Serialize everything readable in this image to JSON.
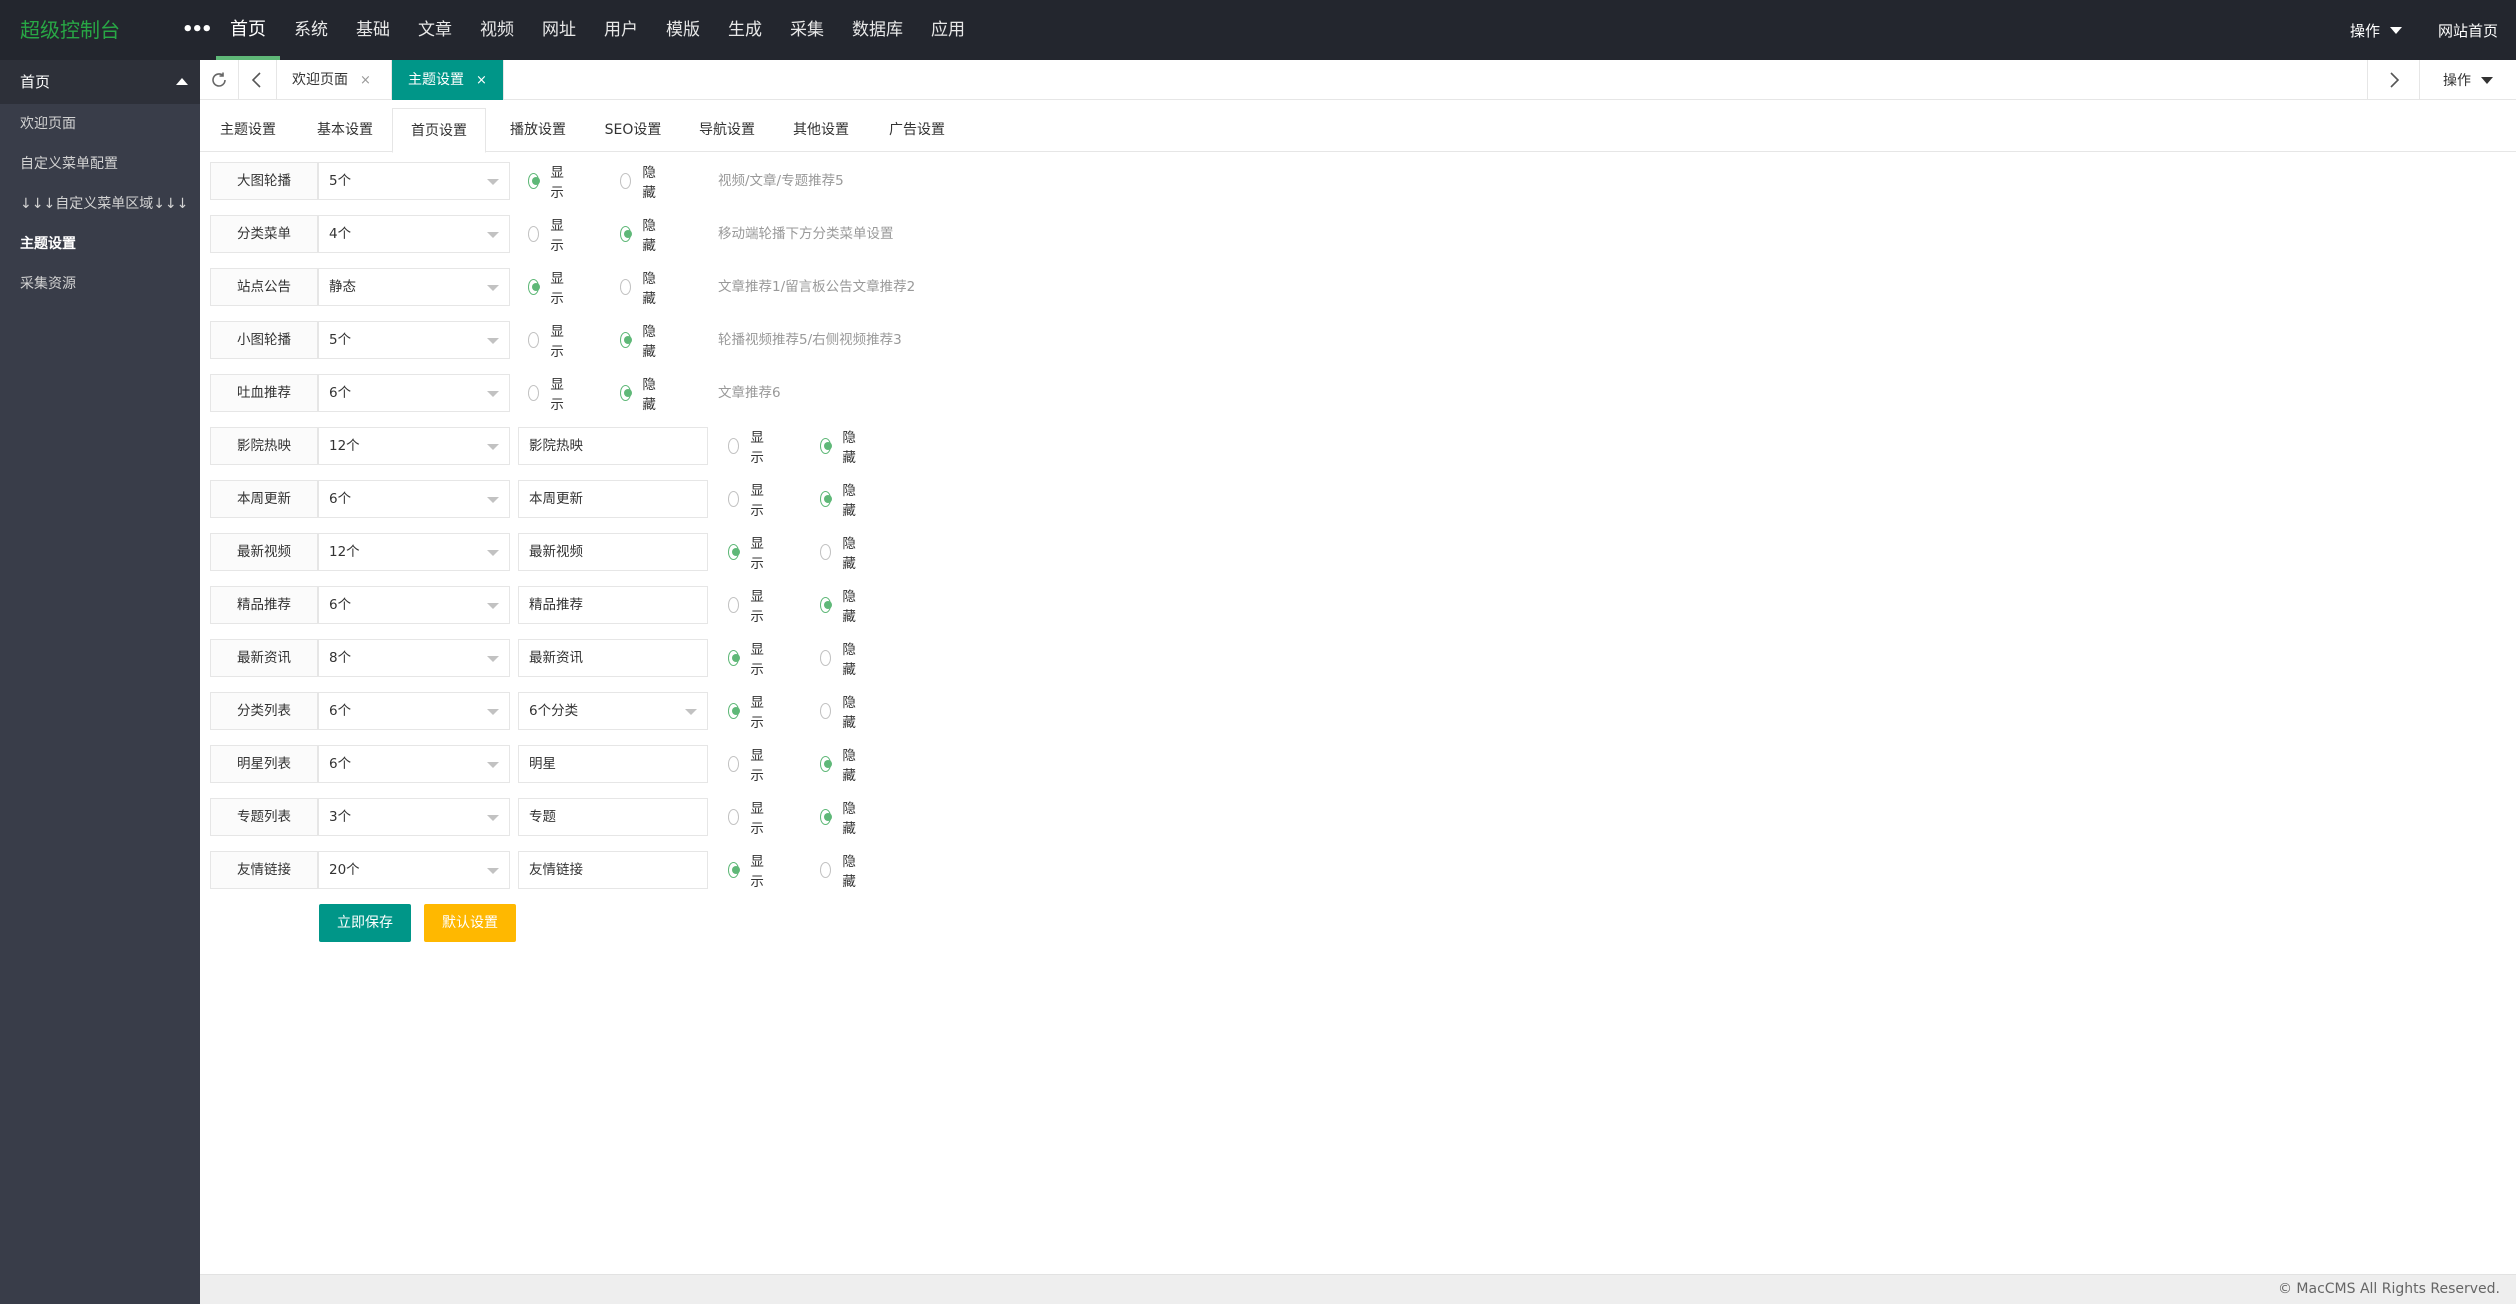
{
  "colors": {
    "accent": "#009688",
    "logo": "#28a745",
    "radio_on": "#5fb878",
    "warn": "#ffb800"
  },
  "header": {
    "logo": "超级控制台",
    "more": "•••",
    "nav": [
      {
        "label": "首页",
        "active": true
      },
      {
        "label": "系统"
      },
      {
        "label": "基础"
      },
      {
        "label": "文章"
      },
      {
        "label": "视频"
      },
      {
        "label": "网址"
      },
      {
        "label": "用户"
      },
      {
        "label": "模版"
      },
      {
        "label": "生成"
      },
      {
        "label": "采集"
      },
      {
        "label": "数据库"
      },
      {
        "label": "应用"
      }
    ],
    "operate": "操作",
    "site_home": "网站首页"
  },
  "sidebar": {
    "group": "首页",
    "items": [
      {
        "label": "欢迎页面"
      },
      {
        "label": "自定义菜单配置"
      },
      {
        "label": "↓↓↓自定义菜单区域↓↓↓"
      },
      {
        "label": "主题设置",
        "active": true
      },
      {
        "label": "采集资源"
      }
    ]
  },
  "tabstrip": {
    "tabs": [
      {
        "label": "欢迎页面",
        "close": "×"
      },
      {
        "label": "主题设置",
        "close": "×",
        "active": true
      }
    ],
    "operate": "操作"
  },
  "subtabs": [
    "主题设置",
    "基本设置",
    "首页设置",
    "播放设置",
    "SEO设置",
    "导航设置",
    "其他设置",
    "广告设置"
  ],
  "radio": {
    "show": "显示",
    "hide": "隐藏"
  },
  "rows_a": [
    {
      "label": "大图轮播",
      "count": "5个",
      "on": "show",
      "hint": "视频/文章/专题推荐5"
    },
    {
      "label": "分类菜单",
      "count": "4个",
      "on": "hide",
      "hint": "移动端轮播下方分类菜单设置"
    },
    {
      "label": "站点公告",
      "count": "静态",
      "on": "show",
      "hint": "文章推荐1/留言板公告文章推荐2"
    },
    {
      "label": "小图轮播",
      "count": "5个",
      "on": "hide",
      "hint": "轮播视频推荐5/右侧视频推荐3"
    },
    {
      "label": "吐血推荐",
      "count": "6个",
      "on": "hide",
      "hint": "文章推荐6"
    }
  ],
  "rows_b": [
    {
      "label": "影院热映",
      "count": "12个",
      "title": "影院热映",
      "on": "hide"
    },
    {
      "label": "本周更新",
      "count": "6个",
      "title": "本周更新",
      "on": "hide"
    },
    {
      "label": "最新视频",
      "count": "12个",
      "title": "最新视频",
      "on": "show"
    },
    {
      "label": "精品推荐",
      "count": "6个",
      "title": "精品推荐",
      "on": "hide"
    },
    {
      "label": "最新资讯",
      "count": "8个",
      "title": "最新资讯",
      "on": "show"
    },
    {
      "label": "分类列表",
      "count": "6个",
      "title": "6个分类",
      "select": true,
      "on": "show"
    },
    {
      "label": "明星列表",
      "count": "6个",
      "title": "明星",
      "on": "hide"
    },
    {
      "label": "专题列表",
      "count": "3个",
      "title": "专题",
      "on": "hide"
    },
    {
      "label": "友情链接",
      "count": "20个",
      "title": "友情链接",
      "on": "show"
    }
  ],
  "buttons": {
    "save": "立即保存",
    "default": "默认设置"
  },
  "footer": "© MacCMS All Rights Reserved."
}
